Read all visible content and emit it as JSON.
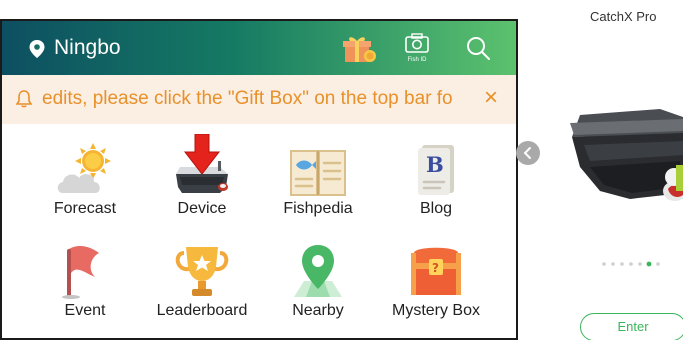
{
  "topbar": {
    "location": "Ningbo",
    "fish_id_label": "Fish ID"
  },
  "notice": {
    "text": "edits, please click the \"Gift Box\" on the top bar fo",
    "close_label": "×"
  },
  "features": [
    {
      "label": "Forecast",
      "icon": "weather-sun-cloud-icon"
    },
    {
      "label": "Device",
      "icon": "bait-boat-device-icon"
    },
    {
      "label": "Fishpedia",
      "icon": "fish-book-icon"
    },
    {
      "label": "Blog",
      "icon": "blog-document-icon"
    },
    {
      "label": "Event",
      "icon": "flag-icon"
    },
    {
      "label": "Leaderboard",
      "icon": "trophy-icon"
    },
    {
      "label": "Nearby",
      "icon": "map-pin-icon"
    },
    {
      "label": "Mystery Box",
      "icon": "treasure-chest-icon"
    }
  ],
  "product": {
    "name": "CatchX Pro",
    "enter_label": "Enter",
    "carousel_active_dot": 5,
    "carousel_dot_count": 7
  },
  "colors": {
    "topbar_start": "#0d4f61",
    "topbar_end": "#5cc26e",
    "notice_bg": "#fbeee3",
    "notice_text": "#e8912a",
    "accent_green": "#3bb55a",
    "arrow_red": "#e3231c"
  }
}
